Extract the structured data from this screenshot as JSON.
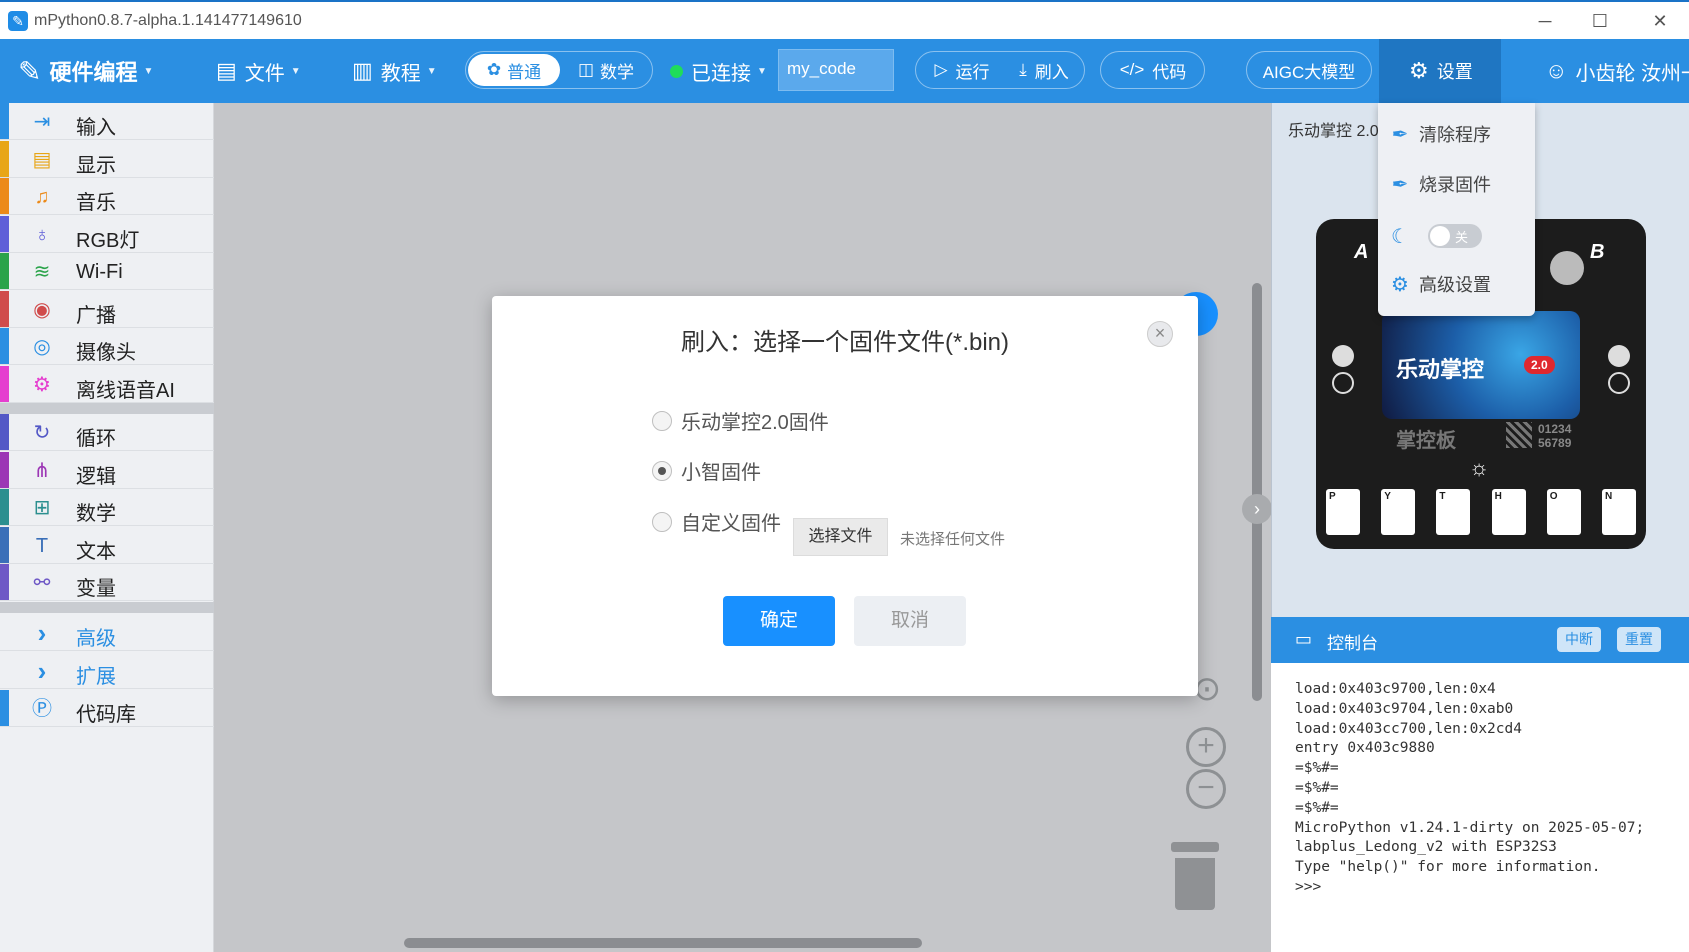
{
  "window": {
    "title": "mPython0.8.7-alpha.1.141477149610",
    "minimize": "─",
    "maximize": "☐",
    "close": "✕"
  },
  "toolbar": {
    "brand": "硬件编程",
    "file": "文件",
    "tutorial": "教程",
    "mode_normal": "普通",
    "mode_math": "数学",
    "connection": "已连接",
    "code_name": "my_code",
    "run": "运行",
    "flash": "刷入",
    "code": "代码",
    "aigc": "AIGC大模型",
    "settings": "设置",
    "user": "小齿轮 汝州一"
  },
  "categories": {
    "group1": [
      {
        "label": "输入",
        "color": "#2b8fe2",
        "icon": "input-icon",
        "glyph": "⇥"
      },
      {
        "label": "显示",
        "color": "#e8a617",
        "icon": "display-icon",
        "glyph": "▤"
      },
      {
        "label": "音乐",
        "color": "#ec8a19",
        "icon": "music-icon",
        "glyph": "♫"
      },
      {
        "label": "RGB灯",
        "color": "#5f5fd8",
        "icon": "bulb-icon",
        "glyph": "♁"
      },
      {
        "label": "Wi-Fi",
        "color": "#2aa34a",
        "icon": "wifi-icon",
        "glyph": "≋"
      },
      {
        "label": "广播",
        "color": "#d04b4b",
        "icon": "broadcast-icon",
        "glyph": "◉"
      },
      {
        "label": "摄像头",
        "color": "#2b8fe2",
        "icon": "camera-icon",
        "glyph": "◎"
      },
      {
        "label": "离线语音AI",
        "color": "#e53ecf",
        "icon": "voice-ai-icon",
        "glyph": "⚙"
      }
    ],
    "group2": [
      {
        "label": "循环",
        "color": "#5358c6",
        "icon": "loop-icon",
        "glyph": "↻"
      },
      {
        "label": "逻辑",
        "color": "#9c36b5",
        "icon": "logic-icon",
        "glyph": "⋔"
      },
      {
        "label": "数学",
        "color": "#2b8f8f",
        "icon": "math-icon",
        "glyph": "⊞"
      },
      {
        "label": "文本",
        "color": "#3a6fb8",
        "icon": "text-icon",
        "glyph": "T"
      },
      {
        "label": "变量",
        "color": "#6e58c6",
        "icon": "variable-icon",
        "glyph": "⚯"
      }
    ],
    "group3": [
      {
        "label": "高级",
        "icon": "chevron-right-icon",
        "glyph": "›"
      },
      {
        "label": "扩展",
        "icon": "chevron-right-icon",
        "glyph": "›"
      },
      {
        "label": "代码库",
        "icon": "code-library-icon",
        "glyph": "Ⓟ"
      }
    ]
  },
  "right_panel": {
    "title": "乐动掌控 2.0",
    "board": {
      "screen_text": "乐动掌控",
      "version": "2.0",
      "brand": "掌控板",
      "serial_1": "01234",
      "serial_2": "56789",
      "label_a": "A",
      "label_b": "B",
      "letters": [
        "P",
        "Y",
        "T",
        "H",
        "O",
        "N"
      ]
    }
  },
  "settings_menu": {
    "clear_program": "清除程序",
    "burn_firmware": "烧录固件",
    "dark_toggle": "关",
    "advanced": "高级设置"
  },
  "console": {
    "title": "控制台",
    "interrupt": "中断",
    "reset": "重置",
    "lines": [
      "load:0x403c9700,len:0x4",
      "load:0x403c9704,len:0xab0",
      "load:0x403cc700,len:0x2cd4",
      "entry 0x403c9880",
      "=$%#=",
      "=$%#=",
      "=$%#=",
      "MicroPython v1.24.1-dirty on 2025-05-07; labplus_Ledong_v2 with ESP32S3",
      "Type \"help()\" for more information.",
      ">>>"
    ]
  },
  "modal": {
    "title": "刷入：选择一个固件文件(*.bin)",
    "options": [
      {
        "label": "乐动掌控2.0固件",
        "checked": false
      },
      {
        "label": "小智固件",
        "checked": true
      },
      {
        "label": "自定义固件",
        "checked": false
      }
    ],
    "choose_file": "选择文件",
    "file_status": "未选择任何文件",
    "confirm": "确定",
    "cancel": "取消",
    "close": "×"
  },
  "colors": {
    "accent": "#2b8fe2",
    "primary_button": "#1890ff",
    "connected": "#1fdc5a"
  }
}
